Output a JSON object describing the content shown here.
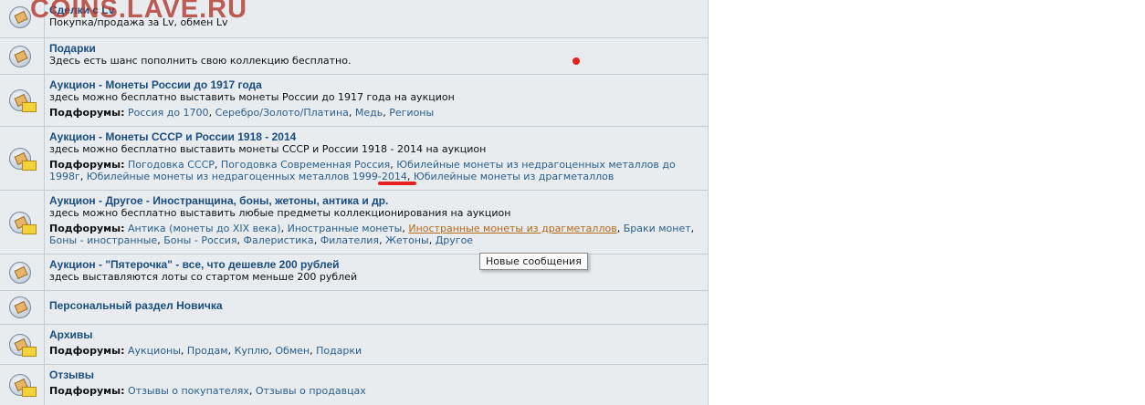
{
  "watermark": "COINS.LAVE.RU",
  "tooltip": "Новые сообщения",
  "subforums_label": "Подфорумы:",
  "forums": [
    {
      "title": "Сделки с Lv",
      "desc": "Покупка/продажа за Lv, обмен Lv",
      "new_posts": false
    },
    {
      "title": "Подарки",
      "desc": "Здесь есть шанс пополнить свою коллекцию бесплатно.",
      "new_posts": false
    },
    {
      "title": "Аукцион - Монеты России до 1917 года",
      "desc": "здесь можно бесплатно выставить монеты России до 1917 года на аукцион",
      "new_posts": true,
      "subforums": [
        "Россия до 1700",
        "Серебро/Золото/Платина",
        "Медь",
        "Регионы"
      ]
    },
    {
      "title": "Аукцион - Монеты СССР и России 1918 - 2014",
      "desc": "здесь можно бесплатно выставить монеты СССР и России 1918 - 2014 на аукцион",
      "new_posts": true,
      "subforums": [
        "Погодовка СССР",
        "Погодовка Современная Россия",
        "Юбилейные монеты из недрагоценных металлов до 1998г",
        "Юбилейные монеты из недрагоценных металлов 1999-2014",
        "Юбилейные монеты из драгметаллов"
      ]
    },
    {
      "title": "Аукцион - Другое - Иностранщина, боны, жетоны, антика и др.",
      "desc": "здесь можно бесплатно выставить любые предметы коллекционирования на аукцион",
      "new_posts": true,
      "subforums": [
        "Антика (монеты до XIX века)",
        "Иностранные монеты",
        "Иностранные монеты из драгметаллов",
        "Браки монет",
        "Боны - иностранные",
        "Боны - Россия",
        "Фалеристика",
        "Филателия",
        "Жетоны",
        "Другое"
      ]
    },
    {
      "title": "Аукцион - \"Пятерочка\" - все, что дешевле 200 рублей",
      "desc": "здесь выставляются лоты со стартом меньше 200 рублей",
      "new_posts": false
    },
    {
      "title": "Персональный раздел Новичка",
      "new_posts": false
    },
    {
      "title": "Архивы",
      "new_posts": true,
      "subforums": [
        "Аукционы",
        "Продам",
        "Куплю",
        "Обмен",
        "Подарки"
      ]
    },
    {
      "title": "Отзывы",
      "new_posts": true,
      "subforums": [
        "Отзывы о покупателях",
        "Отзывы о продавцах"
      ]
    }
  ]
}
